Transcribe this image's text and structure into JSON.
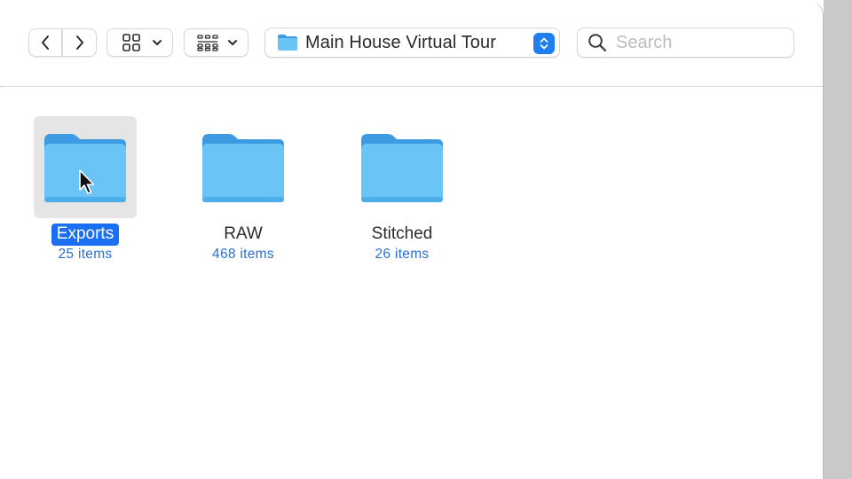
{
  "toolbar": {
    "back_icon": "chevron-left-icon",
    "forward_icon": "chevron-right-icon",
    "view_icon": "grid-view-icon",
    "group_icon": "group-by-icon",
    "path": {
      "title": "Main House Virtual Tour",
      "icon": "folder-icon"
    },
    "search": {
      "placeholder": "Search",
      "value": ""
    }
  },
  "folders": [
    {
      "name": "Exports",
      "count": "25 items",
      "selected": true
    },
    {
      "name": "RAW",
      "count": "468 items",
      "selected": false
    },
    {
      "name": "Stitched",
      "count": "26 items",
      "selected": false
    }
  ],
  "colors": {
    "accent": "#1b6ff2",
    "folder": "#6ac4f5",
    "item_count": "#2a6fd6"
  }
}
